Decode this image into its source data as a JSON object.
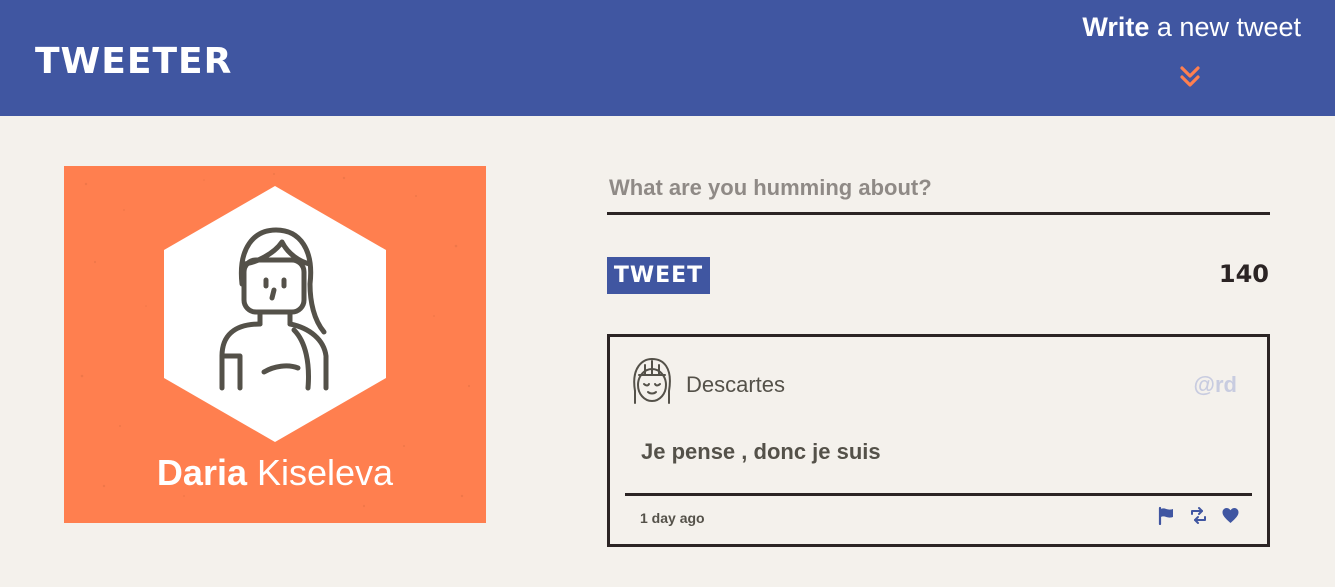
{
  "header": {
    "brand": "TWEETER",
    "compose_strong": "Write",
    "compose_rest": " a new tweet",
    "compose_icon": "double-chevron-down-icon",
    "accent_color": "#ff7f4f",
    "bar_color": "#4056a1"
  },
  "profile": {
    "first_name": "Daria",
    "last_name": " Kiseleva",
    "background_color": "#ff7f4f",
    "avatar_icon": "user-woman-avatar"
  },
  "composer": {
    "placeholder": "What are you humming about?",
    "value": "",
    "button_label": "TWEET",
    "char_count": "140"
  },
  "tweets": [
    {
      "author": "Descartes",
      "handle": "@rd",
      "content": "Je pense , donc je suis",
      "time": "1 day ago",
      "actions": [
        "flag-icon",
        "retweet-icon",
        "heart-icon"
      ]
    }
  ]
}
